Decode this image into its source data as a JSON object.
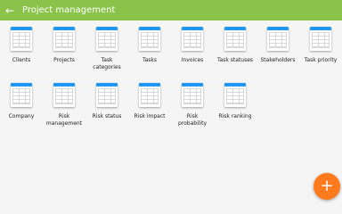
{
  "appbar": {
    "title": "Project management",
    "back_icon": "arrow-left-icon",
    "color": "#8bc34a"
  },
  "tiles": [
    {
      "label": "Clients"
    },
    {
      "label": "Projects"
    },
    {
      "label": "Task\ncategories"
    },
    {
      "label": "Tasks"
    },
    {
      "label": "Invoices"
    },
    {
      "label": "Task statuses"
    },
    {
      "label": "Stakeholders"
    },
    {
      "label": "Task priority"
    },
    {
      "label": "Company"
    },
    {
      "label": "Risk\nmanagement"
    },
    {
      "label": "Risk status"
    },
    {
      "label": "Risk impact"
    },
    {
      "label": "Risk\nprobability"
    },
    {
      "label": "Risk ranking"
    }
  ],
  "fab": {
    "icon": "plus-icon",
    "color": "#ff7a1c"
  }
}
